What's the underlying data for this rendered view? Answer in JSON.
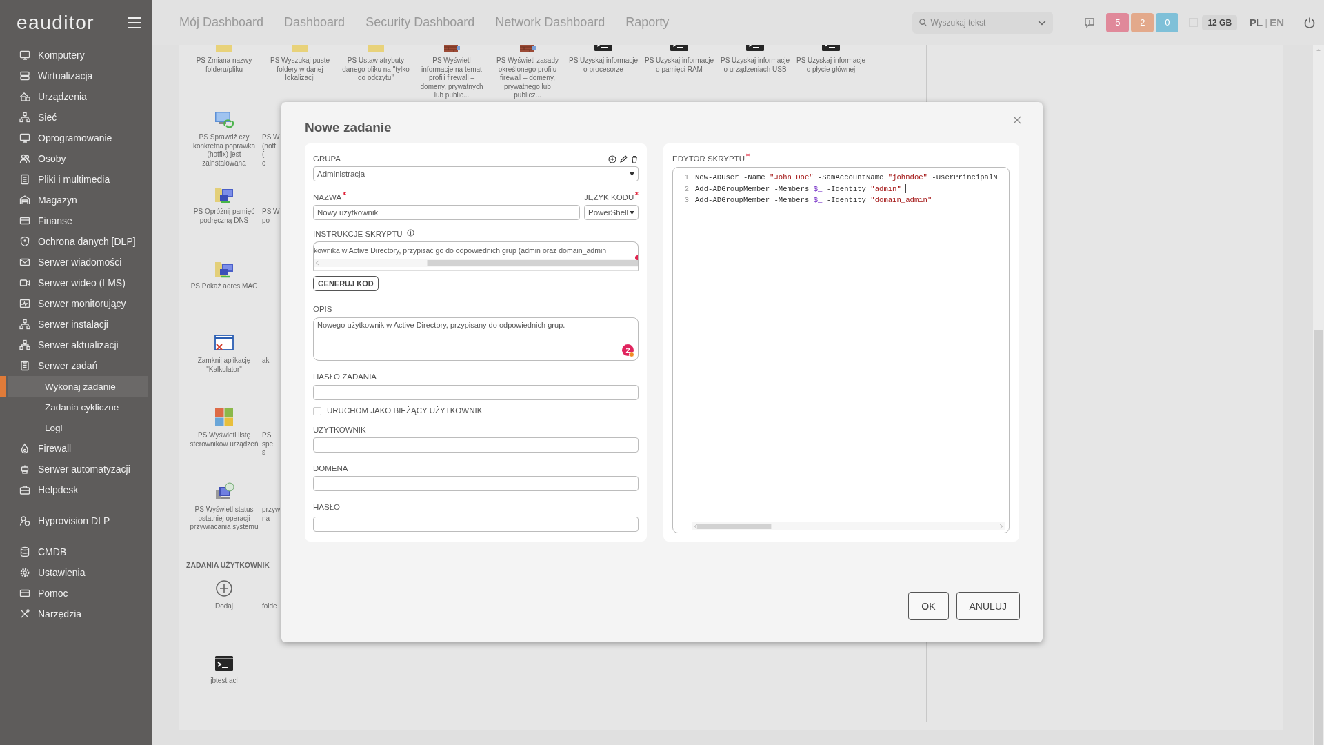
{
  "sidebar": {
    "logo": "eauditor",
    "groups": [
      {
        "items": [
          {
            "label": "Komputery",
            "selected": false
          },
          {
            "label": "Wirtualizacja",
            "selected": false
          },
          {
            "label": "Urządzenia",
            "selected": false
          },
          {
            "label": "Sieć",
            "selected": false
          },
          {
            "label": "Oprogramowanie",
            "selected": false
          },
          {
            "label": "Osoby",
            "selected": false
          },
          {
            "label": "Pliki i multimedia",
            "selected": false
          },
          {
            "label": "Magazyn",
            "selected": false
          },
          {
            "label": "Finanse",
            "selected": false
          },
          {
            "label": "Ochrona danych [DLP]",
            "selected": false
          },
          {
            "label": "Serwer wiadomości",
            "selected": false
          },
          {
            "label": "Serwer wideo (LMS)",
            "selected": false
          },
          {
            "label": "Serwer monitorujący",
            "selected": false
          },
          {
            "label": "Serwer instalacji",
            "selected": false
          },
          {
            "label": "Serwer aktualizacji",
            "selected": false
          },
          {
            "label": "Serwer zadań",
            "selected": false,
            "expanded": true,
            "children": [
              {
                "label": "Wykonaj zadanie",
                "selected": true
              },
              {
                "label": "Zadania cykliczne",
                "selected": false
              },
              {
                "label": "Logi",
                "selected": false
              }
            ]
          },
          {
            "label": "Firewall",
            "selected": false
          },
          {
            "label": "Serwer automatyzacji",
            "selected": false
          },
          {
            "label": "Helpdesk",
            "selected": false
          }
        ]
      },
      {
        "items": [
          {
            "label": "Hyprovision DLP",
            "selected": false
          }
        ]
      },
      {
        "items": [
          {
            "label": "CMDB",
            "selected": false
          },
          {
            "label": "Ustawienia",
            "selected": false
          },
          {
            "label": "Pomoc",
            "selected": false
          },
          {
            "label": "Narzędzia",
            "selected": false
          }
        ]
      }
    ]
  },
  "topbar": {
    "nav": [
      "Mój Dashboard",
      "Dashboard",
      "Security Dashboard",
      "Network Dashboard",
      "Raporty"
    ],
    "search": {
      "placeholder": "Wyszukaj tekst"
    },
    "alerts": [
      {
        "count": "5",
        "color": "#e0899a"
      },
      {
        "count": "2",
        "color": "#e3a98b"
      },
      {
        "count": "0",
        "color": "#7fc0d8"
      }
    ],
    "memory": "12 GB",
    "languages": [
      {
        "label": "PL",
        "selected": true
      },
      {
        "label": "EN",
        "selected": false
      }
    ],
    "language_separator": "|"
  },
  "tasks": {
    "top_row": [
      {
        "kind": "file",
        "label": "PS Zmiana nazwy folderu/pliku"
      },
      {
        "kind": "file",
        "label": "PS Wyszukaj puste foldery w danej lokalizacji"
      },
      {
        "kind": "file",
        "label": "PS Ustaw atrybuty danego pliku na \"tylko do odczytu\""
      },
      {
        "kind": "firewall",
        "label": "PS Wyświetl informacje na temat profili firewall – domeny, prywatnych lub public..."
      },
      {
        "kind": "firewall",
        "label": "PS Wyświetl zasady określonego profilu firewall – domeny, prywatnego lub publicz..."
      },
      {
        "kind": "script",
        "label": "PS Uzyskaj informacje o procesorze"
      },
      {
        "kind": "script",
        "label": "PS Uzyskaj informacje o pamięci RAM"
      },
      {
        "kind": "script",
        "label": "PS Uzyskaj informacje o urządzeniach USB"
      },
      {
        "kind": "script",
        "label": "PS Uzyskaj informacje o płycie głównej"
      }
    ],
    "rows": [
      {
        "tile": {
          "kind": "update",
          "label": "PS Sprawdź czy konkretna poprawka (hotfix) jest zainstalowana"
        },
        "neighbor": [
          "PS W",
          "(hotf",
          "(",
          "c"
        ]
      },
      {
        "tile": {
          "kind": "network",
          "label": "PS Opróżnij pamięć podręczną DNS"
        },
        "neighbor": [
          "PS W",
          "po"
        ]
      },
      {
        "tile": {
          "kind": "network",
          "label": "PS Pokaż adres MAC"
        }
      },
      {
        "tile": {
          "kind": "app",
          "label": "Zamknij aplikację \"Kalkulator\""
        },
        "neighbor": [
          "ak"
        ]
      },
      {
        "tile": {
          "kind": "system",
          "label": "PS Wyświetl listę sterowników urządzeń"
        },
        "neighbor": [
          "PS",
          "spe",
          "s"
        ]
      },
      {
        "tile": {
          "kind": "restore",
          "label": "PS Wyświetl status ostatniej operacji przywracania systemu"
        },
        "neighbor": [
          "przyw",
          "na"
        ]
      }
    ],
    "user_heading": "ZADANIA UŻYTKOWNIK",
    "user_rows": [
      {
        "tile": {
          "kind": "add",
          "label": "Dodaj"
        },
        "neighbor": [
          "folde"
        ]
      },
      {
        "tile": {
          "kind": "script",
          "label": "jbtest acl"
        }
      }
    ]
  },
  "modal": {
    "title": "Nowe zadanie",
    "group": {
      "label": "GRUPA",
      "value": "Administracja"
    },
    "name": {
      "label": "NAZWA",
      "required": true,
      "value": "Nowy użytkownik"
    },
    "language": {
      "label": "JĘZYK KODU",
      "required": true,
      "value": "PowerShell"
    },
    "instructions": {
      "label": "INSTRUKCJE SKRYPTU",
      "value": "kownika w Active Directory, przypisać go do odpowiednich grup (admin oraz domain_admin"
    },
    "generate_button": "GENERUJ KOD",
    "description": {
      "label": "OPIS",
      "value": "Nowego użytkownik w Active Directory, przypisany do odpowiednich grup.",
      "issue_count": "2"
    },
    "task_password": {
      "label": "HASŁO ZADANIA"
    },
    "run_as_current": {
      "label": "URUCHOM JAKO BIEŻĄCY UŻYTKOWNIK",
      "checked": false
    },
    "user": {
      "label": "UŻYTKOWNIK"
    },
    "domain": {
      "label": "DOMENA"
    },
    "password": {
      "label": "HASŁO"
    },
    "editor": {
      "label": "EDYTOR SKRYPTU",
      "required": true,
      "lines": [
        {
          "number": "1",
          "cursor": false,
          "tokens": [
            {
              "kind": "plain",
              "text": "New-ADUser -Name "
            },
            {
              "kind": "string",
              "text": "\"John Doe\""
            },
            {
              "kind": "plain",
              "text": " -SamAccountName "
            },
            {
              "kind": "string",
              "text": "\"johndoe\""
            },
            {
              "kind": "plain",
              "text": " -UserPrincipalN"
            }
          ]
        },
        {
          "number": "2",
          "cursor": true,
          "tokens": [
            {
              "kind": "plain",
              "text": "Add-ADGroupMember -Members "
            },
            {
              "kind": "variable",
              "text": "$_"
            },
            {
              "kind": "plain",
              "text": " -Identity "
            },
            {
              "kind": "string",
              "text": "\"admin\""
            }
          ]
        },
        {
          "number": "3",
          "cursor": false,
          "tokens": [
            {
              "kind": "plain",
              "text": "Add-ADGroupMember -Members "
            },
            {
              "kind": "variable",
              "text": "$_"
            },
            {
              "kind": "plain",
              "text": " -Identity "
            },
            {
              "kind": "string",
              "text": "\"domain_admin\""
            }
          ]
        }
      ]
    },
    "buttons": [
      "OK",
      "ANULUJ"
    ]
  }
}
